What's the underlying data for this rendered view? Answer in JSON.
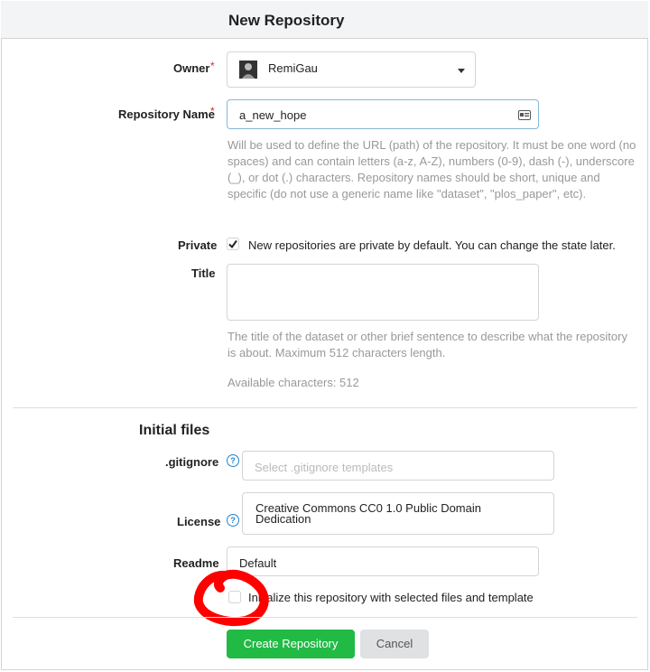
{
  "header": {
    "title": "New Repository"
  },
  "owner": {
    "label": "Owner",
    "value": "RemiGau"
  },
  "repo_name": {
    "label": "Repository Name",
    "value": "a_new_hope",
    "help": "Will be used to define the URL (path) of the repository. It must be one word (no spaces) and can contain letters (a-z, A-Z), numbers (0-9), dash (-), underscore (_), or dot (.) characters. Repository names should be short, unique and specific (do not use a generic name like \"dataset\", \"plos_paper\", etc)."
  },
  "private": {
    "label": "Private",
    "checked": true,
    "text": "New repositories are private by default. You can change the state later."
  },
  "title_field": {
    "label": "Title",
    "value": "",
    "help": "The title of the dataset or other brief sentence to describe what the repository is about. Maximum 512 characters length.",
    "available": "Available characters: 512"
  },
  "initial_files": {
    "heading": "Initial files",
    "gitignore": {
      "label": ".gitignore",
      "placeholder": "Select .gitignore templates"
    },
    "license": {
      "label": "License",
      "value": "Creative Commons CC0 1.0 Public Domain Dedication"
    },
    "readme": {
      "label": "Readme",
      "value": "Default"
    },
    "auto_init": {
      "checked": false,
      "text": "Initialize this repository with selected files and template"
    }
  },
  "actions": {
    "create": "Create Repository",
    "cancel": "Cancel"
  },
  "colors": {
    "primary": "#21ba45",
    "required": "#db2828",
    "checkbox": "#222222",
    "annotation": "#ff0000"
  }
}
